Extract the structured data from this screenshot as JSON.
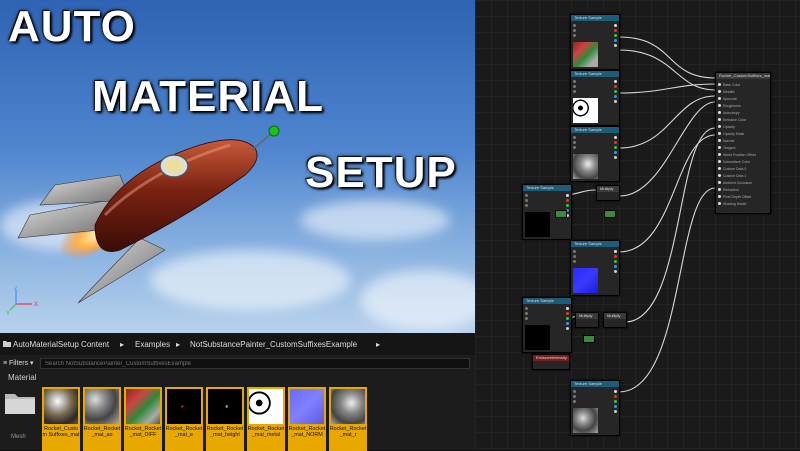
{
  "overlay": {
    "line1": "AUTO",
    "line2": "MATERIAL",
    "line3": "SETUP"
  },
  "axes": {
    "x": "X",
    "y": "Y",
    "z": "Z"
  },
  "content_browser": {
    "breadcrumb": [
      "AutoMaterialSetup Content",
      "Examples",
      "NotSubstancePainter_CustomSuffixesExample"
    ],
    "filters_label": "Filters",
    "search_placeholder": "Search NotSubstancePainter_CustomSuffixesExample",
    "material_tab": "Material",
    "mesh_label": "Mesh",
    "assets": [
      {
        "label": "Rocket_Custom Suffixes_mat",
        "kind": "sphere"
      },
      {
        "label": "Rocket_Rocket_mat_ao",
        "kind": "ao"
      },
      {
        "label": "Rocket_Rocket_mat_DIFF",
        "kind": "diff"
      },
      {
        "label": "Rocket_Rocket_mat_e",
        "kind": "emissive"
      },
      {
        "label": "Rocket_Rocket_mat_height",
        "kind": "height"
      },
      {
        "label": "Rocket_Rocket_mat_metal",
        "kind": "metal"
      },
      {
        "label": "Rocket_Rocket_mat_NORM",
        "kind": "normal"
      },
      {
        "label": "Rocket_Rocket_mat_r",
        "kind": "rough"
      }
    ]
  },
  "graph": {
    "texture_sample_title": "Texture Sample",
    "result_node_title": "Rocket_CustomSuffixes_mat",
    "result_pins": [
      "Base Color",
      "Metallic",
      "Specular",
      "Roughness",
      "Anisotropy",
      "Emissive Color",
      "Opacity",
      "Opacity Mask",
      "Normal",
      "Tangent",
      "World Position Offset",
      "Subsurface Color",
      "Custom Data 0",
      "Custom Data 1",
      "Ambient Occlusion",
      "Refraction",
      "Pixel Depth Offset",
      "Shading Model"
    ],
    "multiply_label": "Multiply",
    "param_label": "EmissiveIntensity"
  }
}
